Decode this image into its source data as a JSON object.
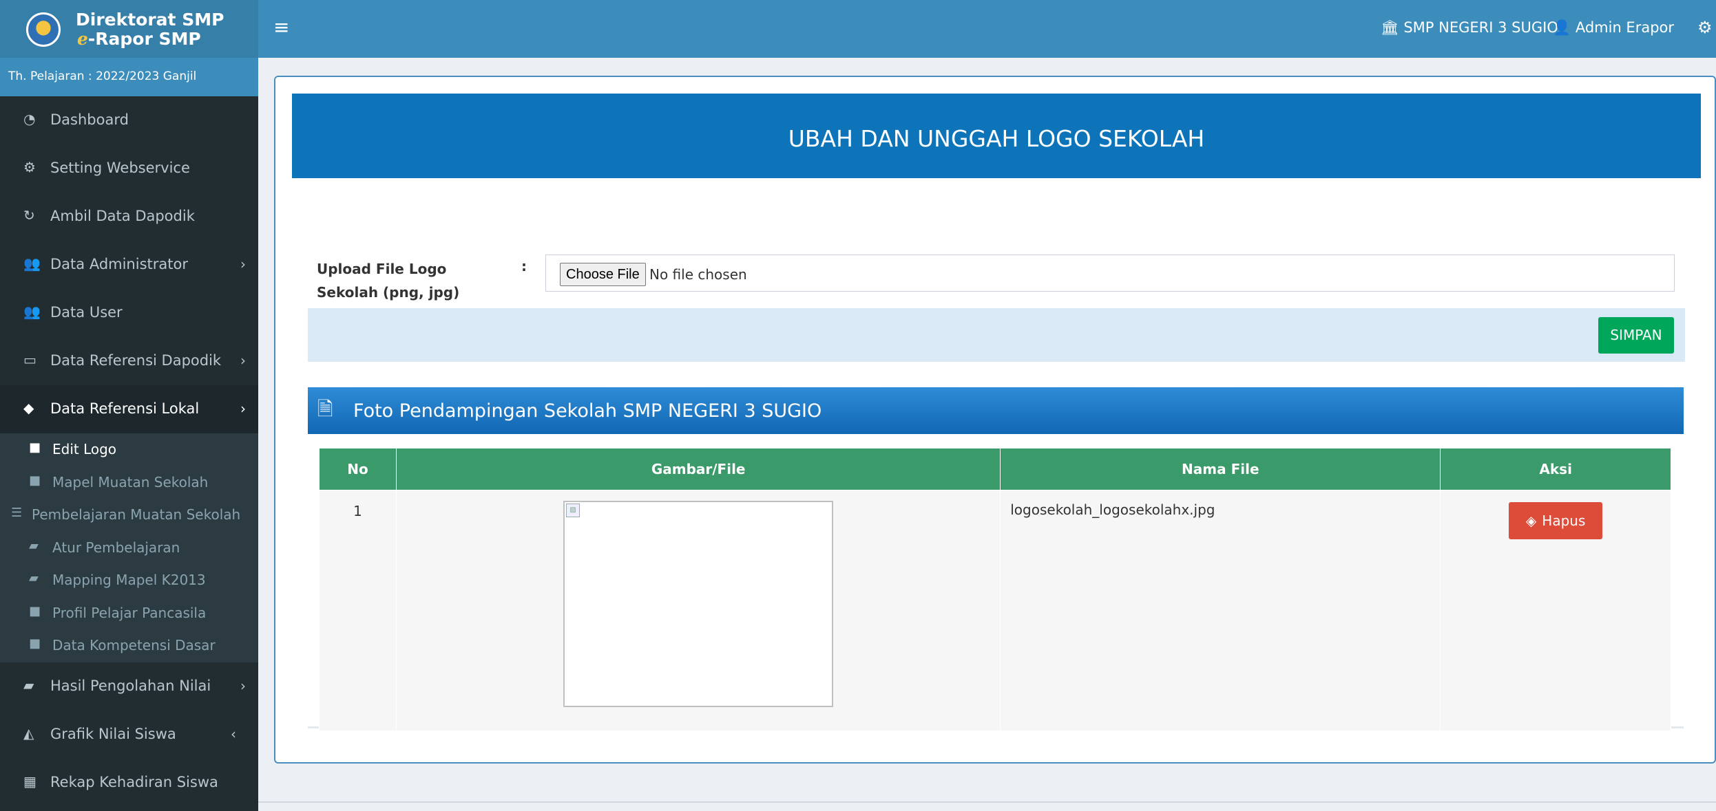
{
  "brand": {
    "title": "Direktorat SMP",
    "sub_e": "e",
    "sub_rest": "-Rapor SMP"
  },
  "tahun_pelajaran": "Th. Pelajaran : 2022/2023 Ganjil",
  "header": {
    "school": "SMP NEGERI 3 SUGIO",
    "admin": "Admin Erapor"
  },
  "menu": {
    "dashboard": "Dashboard",
    "setting": "Setting Webservice",
    "ambil": "Ambil Data Dapodik",
    "admin": "Data Administrator",
    "user": "Data User",
    "ref_dapodik": "Data Referensi Dapodik",
    "ref_lokal": "Data Referensi Lokal",
    "hasil": "Hasil Pengolahan Nilai",
    "grafik": "Grafik Nilai Siswa",
    "rekap": "Rekap Kehadiran Siswa"
  },
  "submenu": {
    "edit_logo": "Edit Logo",
    "mapel_muatan": "Mapel Muatan Sekolah",
    "pembelajaran_muatan": "Pembelajaran Muatan Sekolah",
    "atur": "Atur Pembelajaran",
    "mapping": "Mapping Mapel K2013",
    "profil": "Profil Pelajar Pancasila",
    "kompetensi": "Data Kompetensi Dasar"
  },
  "banner_title": "UBAH DAN UNGGAH LOGO SEKOLAH",
  "upload": {
    "label": "Upload File Logo Sekolah (png, jpg)",
    "colon": ":",
    "choose": "Choose File",
    "no_file": "No file chosen",
    "save": "SIMPAN"
  },
  "section_title": "Foto Pendampingan Sekolah SMP NEGERI 3 SUGIO",
  "table": {
    "headers": {
      "no": "No",
      "gambar": "Gambar/File",
      "nama": "Nama File",
      "aksi": "Aksi"
    },
    "rows": [
      {
        "no": "1",
        "nama": "logosekolah_logosekolahx.jpg",
        "aksi": "Hapus"
      }
    ]
  }
}
